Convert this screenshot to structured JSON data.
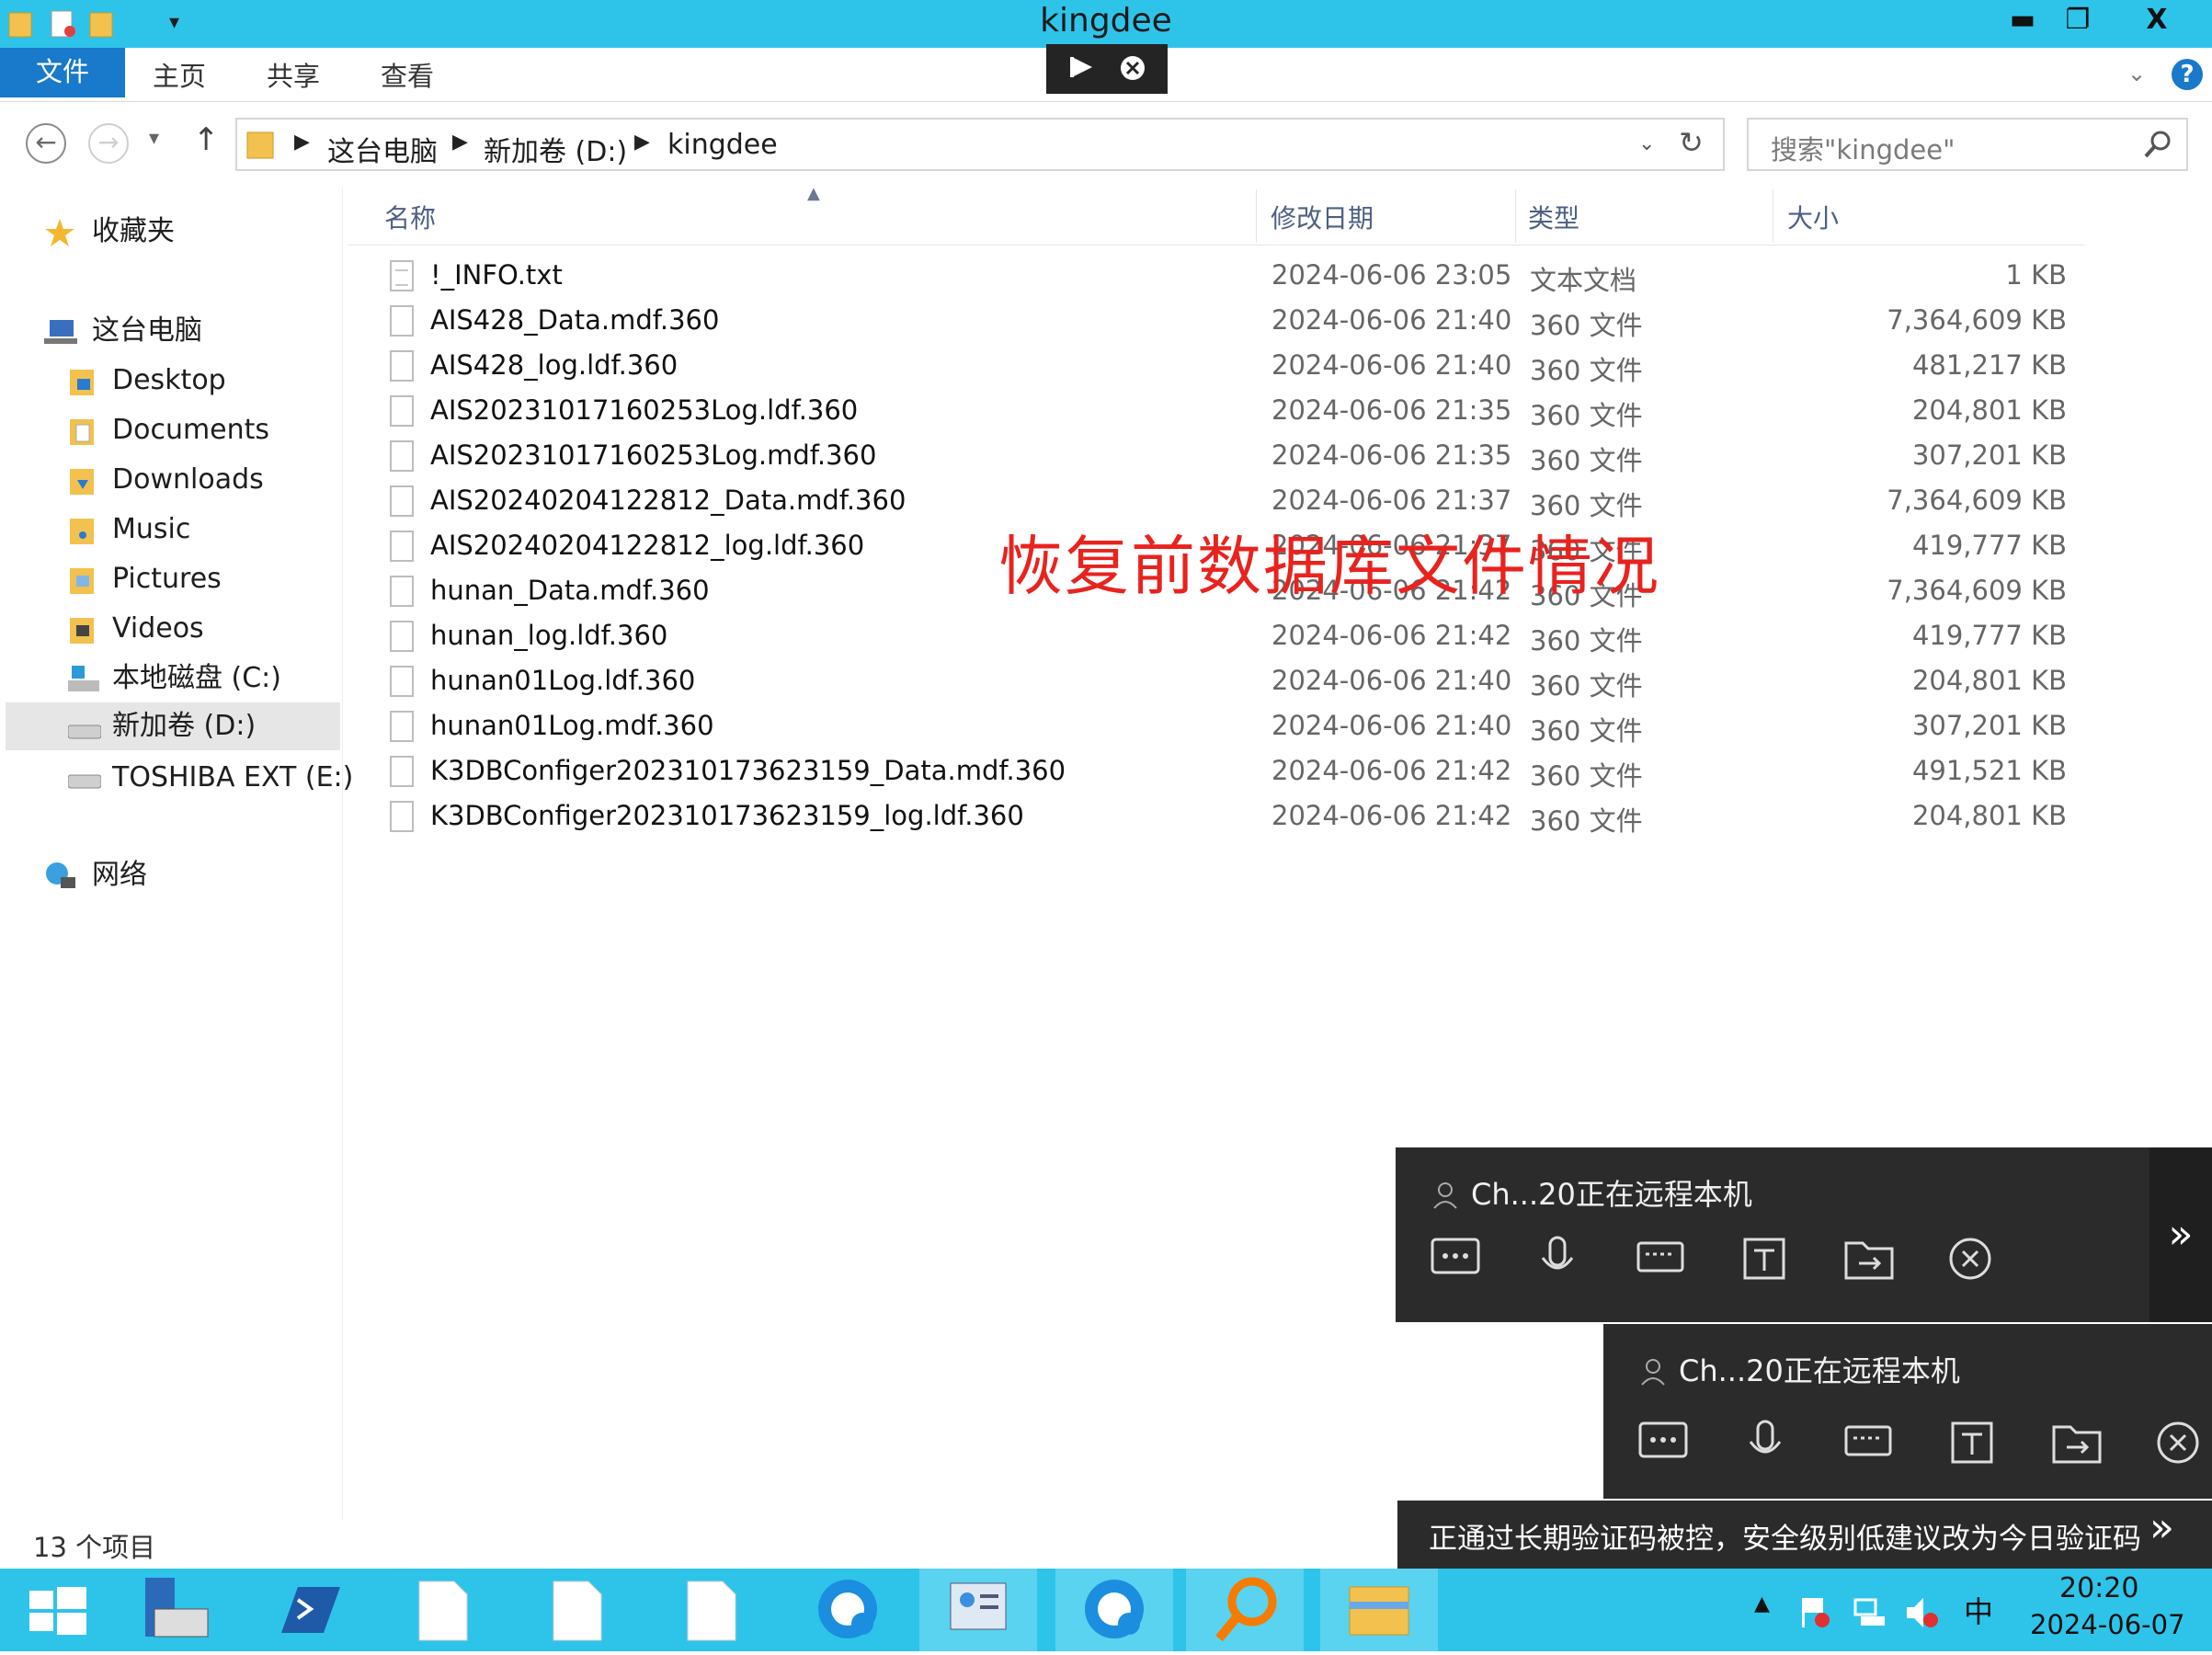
{
  "window": {
    "title": "kingdee",
    "minimize_glyph": "▬",
    "restore_glyph": "❐",
    "close_glyph": "X"
  },
  "ribbon": {
    "tabs": [
      "文件",
      "主页",
      "共享",
      "查看"
    ],
    "help_glyph": "?"
  },
  "address": {
    "crumbs": [
      "这台电脑",
      "新加卷 (D:)",
      "kingdee"
    ],
    "search_placeholder": "搜索\"kingdee\""
  },
  "sidebar": {
    "favorites": "收藏夹",
    "this_pc": "这台电脑",
    "items": [
      "Desktop",
      "Documents",
      "Downloads",
      "Music",
      "Pictures",
      "Videos",
      "本地磁盘 (C:)",
      "新加卷 (D:)",
      "TOSHIBA EXT (E:)"
    ],
    "network": "网络",
    "selected": "新加卷 (D:)"
  },
  "columns": {
    "name": "名称",
    "date": "修改日期",
    "type": "类型",
    "size": "大小"
  },
  "files": [
    {
      "name": "!_INFO.txt",
      "date": "2024-06-06 23:05",
      "type": "文本文档",
      "size": "1 KB",
      "icon": "text-file-icon"
    },
    {
      "name": "AIS428_Data.mdf.360",
      "date": "2024-06-06 21:40",
      "type": "360 文件",
      "size": "7,364,609 KB",
      "icon": "file-icon"
    },
    {
      "name": "AIS428_log.ldf.360",
      "date": "2024-06-06 21:40",
      "type": "360 文件",
      "size": "481,217 KB",
      "icon": "file-icon"
    },
    {
      "name": "AIS20231017160253Log.ldf.360",
      "date": "2024-06-06 21:35",
      "type": "360 文件",
      "size": "204,801 KB",
      "icon": "file-icon"
    },
    {
      "name": "AIS20231017160253Log.mdf.360",
      "date": "2024-06-06 21:35",
      "type": "360 文件",
      "size": "307,201 KB",
      "icon": "file-icon"
    },
    {
      "name": "AIS20240204122812_Data.mdf.360",
      "date": "2024-06-06 21:37",
      "type": "360 文件",
      "size": "7,364,609 KB",
      "icon": "file-icon"
    },
    {
      "name": "AIS20240204122812_log.ldf.360",
      "date": "2024-06-06 21:37",
      "type": "360 文件",
      "size": "419,777 KB",
      "icon": "file-icon"
    },
    {
      "name": "hunan_Data.mdf.360",
      "date": "2024-06-06 21:42",
      "type": "360 文件",
      "size": "7,364,609 KB",
      "icon": "file-icon"
    },
    {
      "name": "hunan_log.ldf.360",
      "date": "2024-06-06 21:42",
      "type": "360 文件",
      "size": "419,777 KB",
      "icon": "file-icon"
    },
    {
      "name": "hunan01Log.ldf.360",
      "date": "2024-06-06 21:40",
      "type": "360 文件",
      "size": "204,801 KB",
      "icon": "file-icon"
    },
    {
      "name": "hunan01Log.mdf.360",
      "date": "2024-06-06 21:40",
      "type": "360 文件",
      "size": "307,201 KB",
      "icon": "file-icon"
    },
    {
      "name": "K3DBConfiger202310173623159_Data.mdf.360",
      "date": "2024-06-06 21:42",
      "type": "360 文件",
      "size": "491,521 KB",
      "icon": "file-icon"
    },
    {
      "name": "K3DBConfiger202310173623159_log.ldf.360",
      "date": "2024-06-06 21:42",
      "type": "360 文件",
      "size": "204,801 KB",
      "icon": "file-icon"
    }
  ],
  "overlay_text": "恢复前数据库文件情况",
  "status": {
    "item_count": "13 个项目"
  },
  "remote": {
    "panel_title": "Ch...20正在远程本机",
    "expand_glyph": "»",
    "notice": "正通过长期验证码被控，安全级别低建议改为今日验证码"
  },
  "taskbar": {
    "ime": "中",
    "time": "20:20",
    "date": "2024-06-07"
  },
  "colors": {
    "titlebar": "#2ec4ea",
    "file_tab": "#1979ca",
    "overlay_red": "#e8231e",
    "remote_panel": "#2b2b2b"
  }
}
